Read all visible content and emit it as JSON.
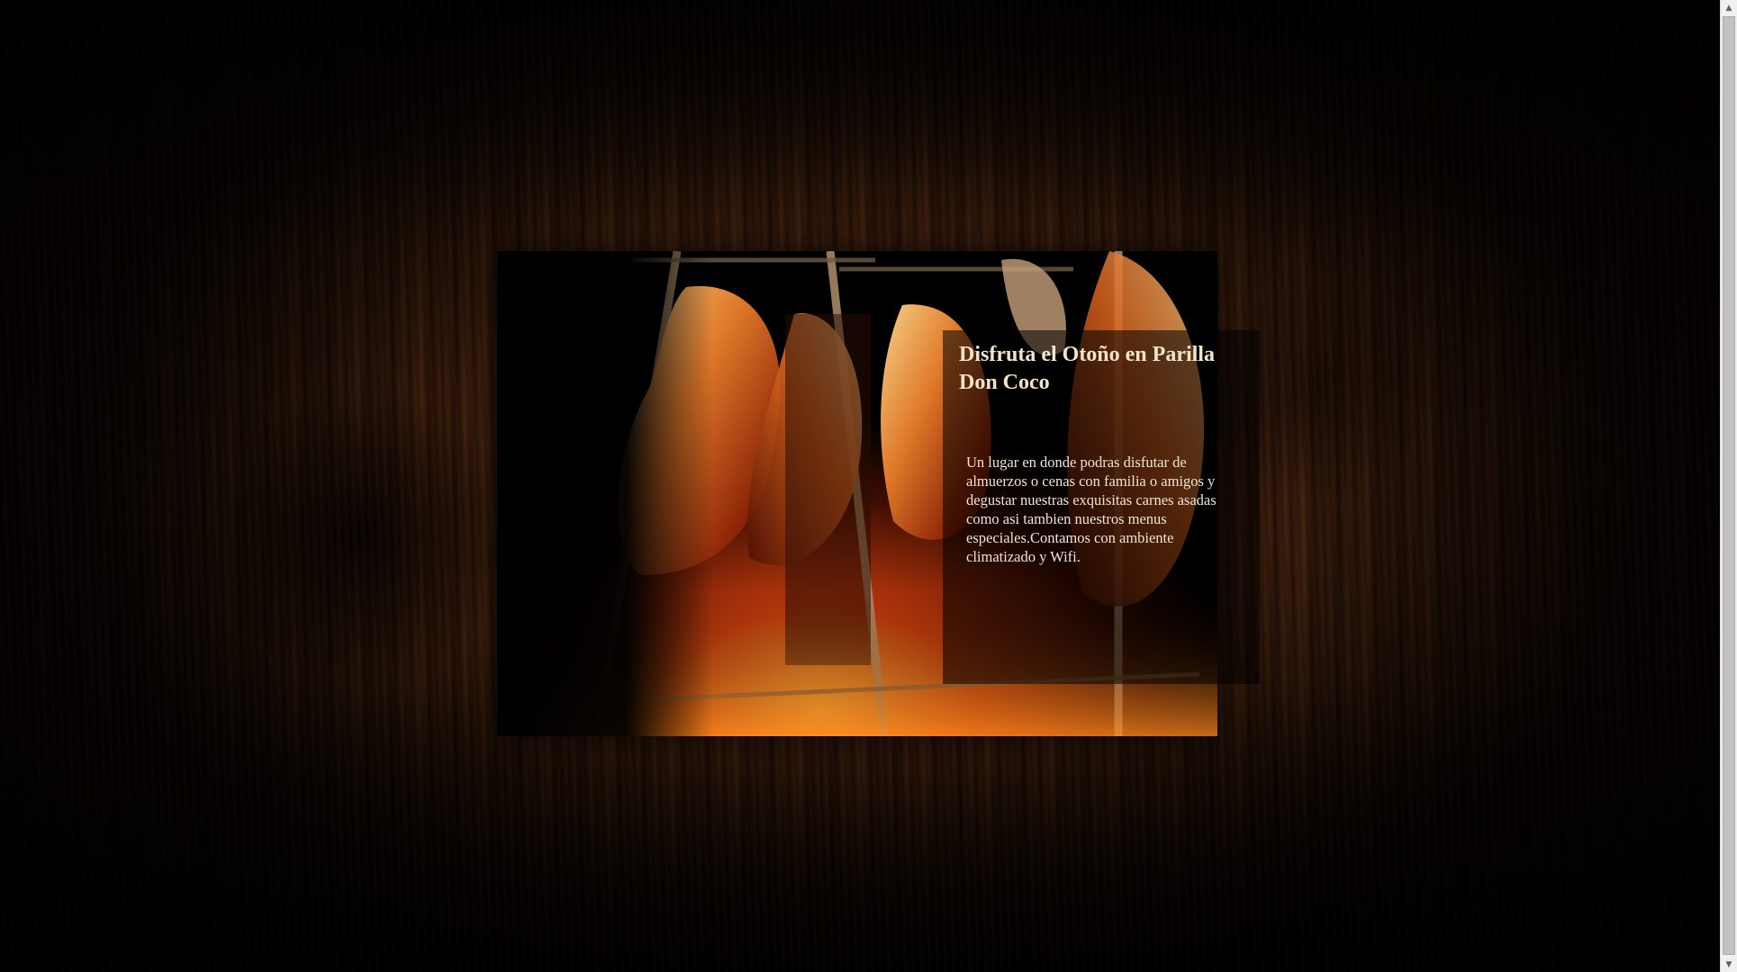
{
  "promo": {
    "title": "Disfruta el Otoño en Parilla Don Coco",
    "description": "Un lugar en donde podras disfutar de almuerzos o cenas con familia o amigos y degustar nuestras exquisitas carnes asadas como asi tambien nuestros menus especiales.Contamos con ambiente climatizado y Wifi."
  },
  "scrollbar": {
    "up_icon": "triangle-up-icon",
    "down_icon": "triangle-down-icon"
  },
  "colors": {
    "title_text": "#f3e3c8",
    "body_text": "#f0e4d2",
    "overlay": "rgba(0,0,0,0.55)",
    "wood": "#3a1c0c"
  }
}
